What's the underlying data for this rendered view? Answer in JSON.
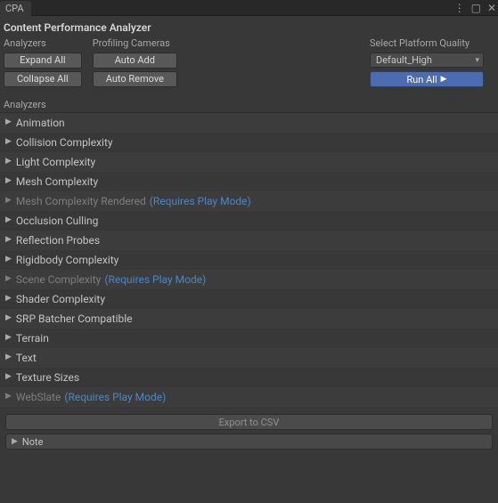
{
  "tab_title": "CPA",
  "header_title": "Content Performance Analyzer",
  "toolbar": {
    "col_analyzers_label": "Analyzers",
    "col_profiling_label": "Profiling Cameras",
    "expand_all": "Expand All",
    "collapse_all": "Collapse All",
    "auto_add": "Auto Add",
    "auto_remove": "Auto Remove",
    "platform_label": "Select Platform Quality",
    "platform_value": "Default_High",
    "run_all": "Run All"
  },
  "analyzers_section_label": "Analyzers",
  "analyzers": [
    {
      "label": "Animation",
      "dim": false,
      "requires": false
    },
    {
      "label": "Collision Complexity",
      "dim": false,
      "requires": false
    },
    {
      "label": "Light Complexity",
      "dim": false,
      "requires": false
    },
    {
      "label": "Mesh Complexity",
      "dim": false,
      "requires": false
    },
    {
      "label": "Mesh Complexity Rendered",
      "dim": true,
      "requires": true
    },
    {
      "label": "Occlusion Culling",
      "dim": false,
      "requires": false
    },
    {
      "label": "Reflection Probes",
      "dim": false,
      "requires": false
    },
    {
      "label": "Rigidbody Complexity",
      "dim": false,
      "requires": false
    },
    {
      "label": "Scene Complexity",
      "dim": true,
      "requires": true
    },
    {
      "label": "Shader Complexity",
      "dim": false,
      "requires": false
    },
    {
      "label": "SRP Batcher Compatible",
      "dim": false,
      "requires": false
    },
    {
      "label": "Terrain",
      "dim": false,
      "requires": false
    },
    {
      "label": "Text",
      "dim": false,
      "requires": false
    },
    {
      "label": "Texture Sizes",
      "dim": false,
      "requires": false
    },
    {
      "label": "WebSlate",
      "dim": true,
      "requires": true
    }
  ],
  "requires_play_mode_text": "(Requires Play Mode)",
  "export_label": "Export to CSV",
  "note_label": "Note"
}
